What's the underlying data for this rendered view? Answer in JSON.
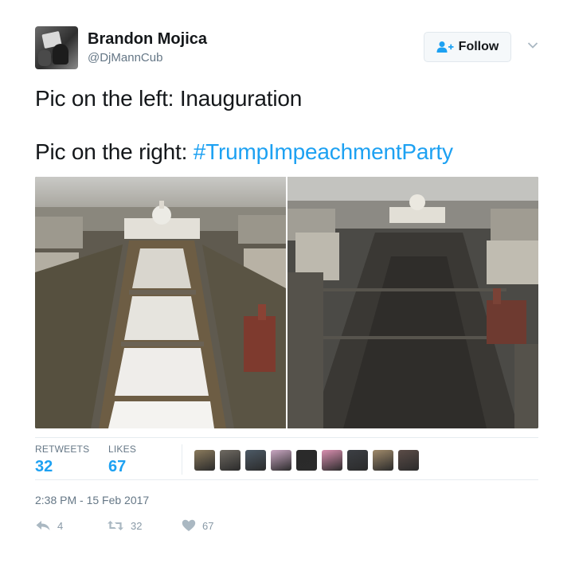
{
  "user": {
    "display_name": "Brandon Mojica",
    "handle": "@DjMannCub",
    "avatar_icon": "profile-photo"
  },
  "follow_button": {
    "label": "Follow",
    "icon": "person-plus-icon",
    "accent": "#1da1f2"
  },
  "tweet": {
    "line1": "Pic on the left: Inauguration",
    "line2_prefix": "Pic on the right: ",
    "hashtag": "#TrumpImpeachmentParty",
    "hashtag_color": "#1da1f2"
  },
  "media": [
    {
      "side": "left",
      "icon": "aerial-photo-inauguration-crowd"
    },
    {
      "side": "right",
      "icon": "aerial-photo-comparison-crowd"
    }
  ],
  "stats": {
    "retweets_label": "RETWEETS",
    "retweets_count": "32",
    "likes_label": "LIKES",
    "likes_count": "67"
  },
  "likers": [
    {
      "color": "#8a7a5c"
    },
    {
      "color": "#6f6a62"
    },
    {
      "color": "#4d5a66"
    },
    {
      "color": "#c9a7c2"
    },
    {
      "color": "#2a2a2a"
    },
    {
      "color": "#d98fb0"
    },
    {
      "color": "#3c3f44"
    },
    {
      "color": "#a08a6a"
    },
    {
      "color": "#5b4c47"
    }
  ],
  "timestamp": "2:38 PM - 15 Feb 2017",
  "actions": {
    "reply_count": "4",
    "retweet_count": "32",
    "like_count": "67"
  },
  "colors": {
    "text_primary": "#14171a",
    "text_secondary": "#657786",
    "border": "#e6ecf0"
  }
}
